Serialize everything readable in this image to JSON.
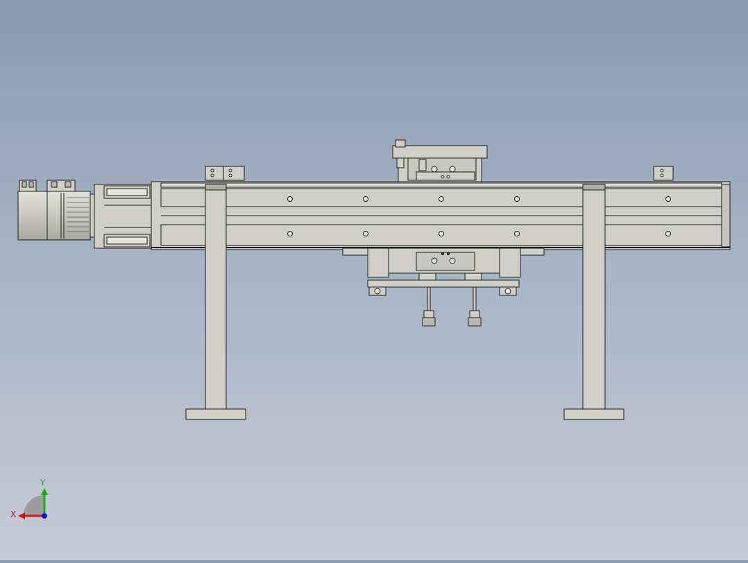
{
  "colors": {
    "part_fill": "#cfcfc7",
    "part_shade": "#b9b9b1",
    "part_edge": "#1a1a1a",
    "motor_dark": "#9a9a92",
    "axis_x": "#e01010",
    "axis_y": "#10b010",
    "axis_z": "#1010e0"
  },
  "triad": {
    "x_label": "X",
    "y_label": "Y"
  },
  "model": {
    "icon": "cad-3d-assembly-icon"
  }
}
